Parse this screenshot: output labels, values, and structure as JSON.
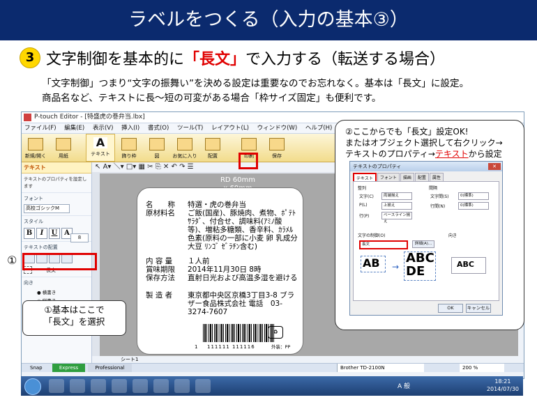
{
  "banner": {
    "title": "ラベルをつくる（入力の基本③）"
  },
  "step": {
    "number": "3",
    "text_before": "文字制御を基本的に",
    "highlight": "「長文」",
    "text_after": "で入力する（転送する場合）"
  },
  "description": {
    "line1": "「文字制御」つまり“文字の振舞い”を決める設定は重要なのでお忘れなく。基本は「長文」に設定。",
    "line2": "商品名など、テキストに長〜短の可変がある場合「枠サイズ固定」も便利です。"
  },
  "window": {
    "title": "P-touch Editor - [特盛虎の巻弁当.lbx]",
    "menu": [
      "ファイル(F)",
      "編集(E)",
      "表示(V)",
      "挿入(I)",
      "書式(O)",
      "ツール(T)",
      "レイアウト(L)",
      "ウィンドウ(W)",
      "ヘルプ(H)"
    ],
    "ribbon": [
      "新規/開く",
      "用紙",
      "テキスト",
      "飾り枠",
      "図",
      "お気に入り",
      "配置",
      "印刷",
      "保存"
    ],
    "panel": {
      "header": "テキスト",
      "subtitle": "テキストのプロパティを設定します",
      "font_section": "フォント",
      "font_name": "高校ゴシックM",
      "font_size": "8",
      "style_section": "スタイル",
      "style_buttons": [
        "B",
        "I",
        "U",
        "A"
      ],
      "layout_section": "テキストの配置",
      "control_value": "長文",
      "direction_section": "向き",
      "direction_options": [
        "横書き",
        "縦書き"
      ]
    },
    "label_size": {
      "line1": "RD 60mm",
      "line2": "x 60mm"
    },
    "label_rows": [
      {
        "key": "名　　称",
        "value": "特選・虎の巻弁当"
      },
      {
        "key": "原材料名",
        "value": "ご飯(国産)、豚焼肉、煮物、ﾎﾟﾃﾄｻﾗﾀﾞ、付合せ、調味料(ｱﾐﾉ酸等)、増粘多糖類、香辛料、ｶﾗﾒﾙ色素(原料の一部に小麦 卵 乳成分 大豆 ﾘﾝｺﾞ ｾﾞﾗﾁﾝ含む)"
      },
      {
        "key": "内 容 量",
        "value": "１人前"
      },
      {
        "key": "賞味期限",
        "value": "2014年11月30日 8時"
      },
      {
        "key": "保存方法",
        "value": "直射日光および高温多湿を避ける"
      },
      {
        "key": "製 造 者",
        "value": "東京都中央区京橋3丁目3-8 ブラザー食品株式会社 電話　03-3274-7607"
      }
    ],
    "barcode_digit": "1",
    "barcode_number": "111111 111116",
    "recycle_text": "外装：PP",
    "sheet_tab": "シート1",
    "status": {
      "snap": "Snap",
      "express": "Express",
      "professional": "Professional",
      "printer": "Brother TD-2100N",
      "zoom": "200 %"
    }
  },
  "taskbar": {
    "lang": "A 般",
    "time": "18:21",
    "date": "2014/07/30"
  },
  "callout_left": {
    "marker": "①",
    "line1": "①基本はここで",
    "line2": "「長文」を選択"
  },
  "callout_right": {
    "line1": "②ここからでも「長文」設定OK!",
    "line2": "またはオブジェクト選択して右クリック→",
    "line3_before": "テキストのプロパティ→",
    "line3_link": "テキスト",
    "line3_after": "から設定"
  },
  "dialog": {
    "title": "テキストのプロパティ",
    "tabs": [
      "テキスト",
      "フォント",
      "描画",
      "配置",
      "属性"
    ],
    "align_label": "整列",
    "text_h_label": "文字(C)",
    "text_h_value": "両端揃え",
    "p_label": "P(L)",
    "p_value": "上揃え",
    "line_label": "行(P)",
    "line_value": "ベースライン揃え",
    "spacing_label": "間隔",
    "char_space_label": "文字間(S)",
    "char_space_value": "0(標準)",
    "line_space_label": "行間(N)",
    "line_space_value": "0(標準)",
    "control_label": "文字の制御(O)",
    "control_value": "長文",
    "detail_button": "詳細(A)...",
    "direction_label": "向き",
    "example_small": "AB",
    "example_large_1": "ABC",
    "example_large_2": "DE",
    "example_direction": "ABC",
    "ok": "OK",
    "cancel": "キャンセル"
  }
}
